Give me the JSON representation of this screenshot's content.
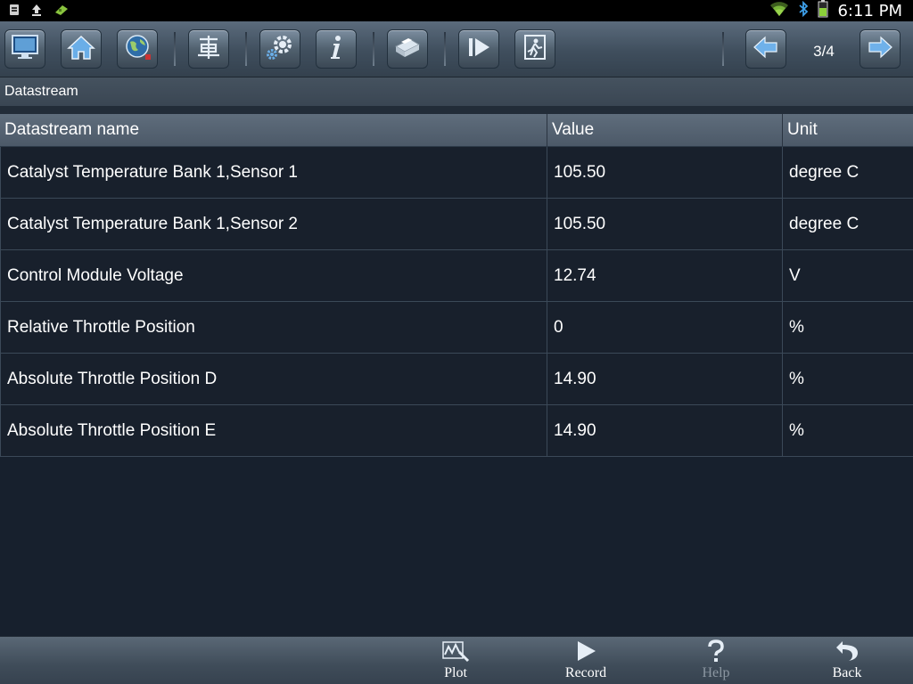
{
  "status_bar": {
    "time": "6:11 PM",
    "left_icons": [
      "sim-card-icon",
      "upload-icon",
      "usb-debug-icon"
    ],
    "right_icons": [
      "wifi-icon",
      "bluetooth-icon",
      "battery-icon"
    ]
  },
  "toolbar": {
    "buttons": [
      {
        "name": "display-icon"
      },
      {
        "name": "home-icon"
      },
      {
        "name": "globe-icon"
      },
      {
        "name": "vehicle-icon"
      },
      {
        "name": "settings-gear-icon"
      },
      {
        "name": "info-icon"
      },
      {
        "name": "print-icon"
      },
      {
        "name": "play-next-icon"
      },
      {
        "name": "exit-icon"
      }
    ],
    "prev_icon": "arrow-left-icon",
    "next_icon": "arrow-right-icon",
    "page_indicator": "3/4"
  },
  "section": {
    "title": "Datastream"
  },
  "table": {
    "columns": [
      "Datastream name",
      "Value",
      "Unit"
    ],
    "rows": [
      {
        "name": "Catalyst Temperature Bank 1,Sensor 1",
        "value": "105.50",
        "unit": "degree C"
      },
      {
        "name": "Catalyst Temperature Bank 1,Sensor 2",
        "value": "105.50",
        "unit": "degree C"
      },
      {
        "name": "Control Module Voltage",
        "value": "12.74",
        "unit": "V"
      },
      {
        "name": "Relative Throttle Position",
        "value": "0",
        "unit": "%"
      },
      {
        "name": "Absolute Throttle Position D",
        "value": "14.90",
        "unit": "%"
      },
      {
        "name": "Absolute Throttle Position E",
        "value": "14.90",
        "unit": "%"
      }
    ]
  },
  "bottom_bar": {
    "plot_label": "Plot",
    "record_label": "Record",
    "help_label": "Help",
    "back_label": "Back"
  },
  "colors": {
    "background": "#17202d",
    "toolbar_accent": "#4f7fb3",
    "disabled_text": "#8b96a1"
  }
}
